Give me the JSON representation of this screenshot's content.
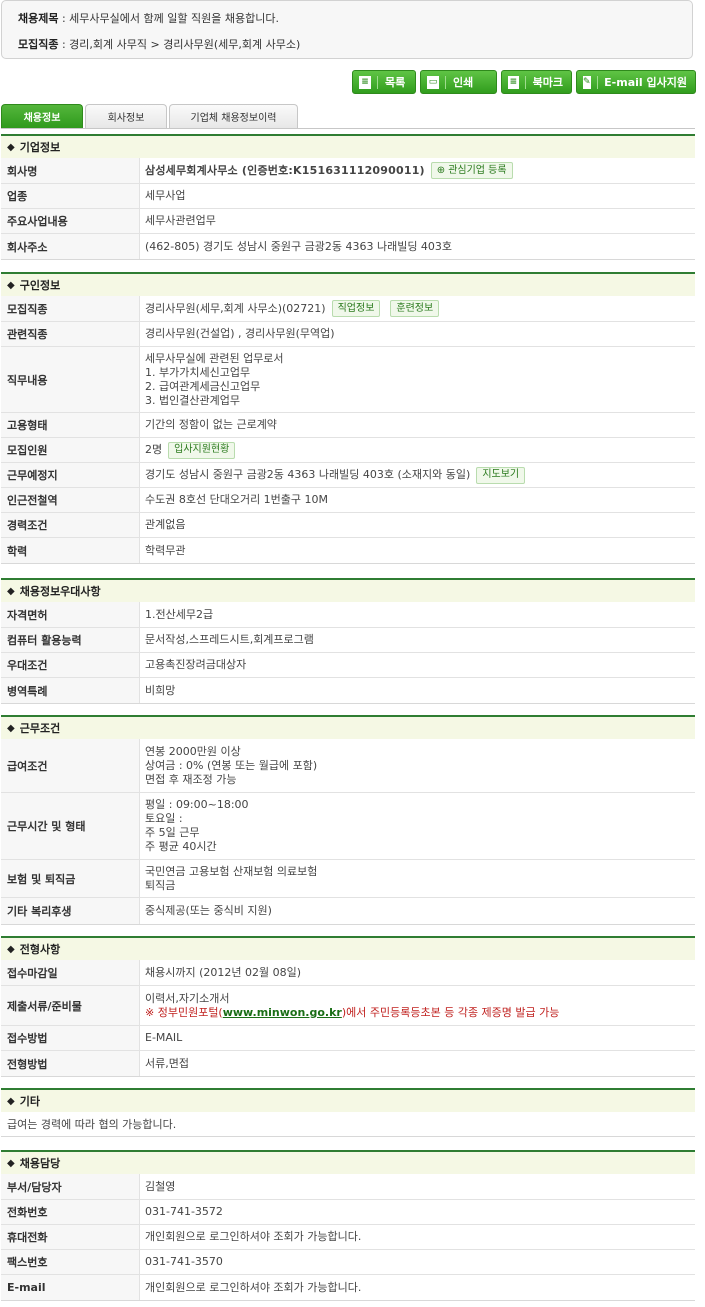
{
  "summary": {
    "title_label": "채용제목",
    "title_value": ": 세무사무실에서 함께 일할 직원을 채용합니다.",
    "job_label": "모집직종",
    "job_value": ": 경리,회계 사무직 > 경리사무원(세무,회계 사무소)"
  },
  "toolbar": {
    "list": "목록",
    "print": "인쇄",
    "bookmark": "북마크",
    "email_apply": "E-mail 입사지원"
  },
  "tabs": [
    "채용정보",
    "회사정보",
    "기업체 채용정보이력"
  ],
  "company": {
    "title": "기업정보",
    "name_label": "회사명",
    "name_value": "삼성세무회계사무소",
    "cert_value": "(인증번호:K151631112090011)",
    "interest_button": "관심기업 등록",
    "industry_label": "업종",
    "industry_value": "세무사업",
    "business_label": "주요사업내용",
    "business_value": "세무사관련업무",
    "address_label": "회사주소",
    "address_value": "(462-805) 경기도 성남시 중원구 금광2동 4363 나래빌딩 403호"
  },
  "recruit": {
    "title": "구인정보",
    "job_label": "모집직종",
    "job_value": "경리사무원(세무,회계 사무소)(02721)",
    "job_info_btn": "직업정보",
    "training_btn": "훈련정보",
    "related_label": "관련직종",
    "related_value": "경리사무원(건설업) , 경리사무원(무역업)",
    "duty_label": "직무내용",
    "duty_lines": [
      "세무사무실에 관련된 업무로서",
      "1. 부가가치세신고업무",
      "2. 급여관계세금신고업무",
      "3. 법인결산관계업무"
    ],
    "employ_label": "고용형태",
    "employ_value": "기간의 정함이 없는 근로계약",
    "count_label": "모집인원",
    "count_value": "2명",
    "count_btn": "입사지원현황",
    "location_label": "근무예정지",
    "location_value": "경기도 성남시 중원구 금광2동 4363 나래빌딩 403호 (소재지와 동일)",
    "map_btn": "지도보기",
    "subway_label": "인근전철역",
    "subway_value": "수도권 8호선 단대오거리 1번출구 10M",
    "career_label": "경력조건",
    "career_value": "관계없음",
    "edu_label": "학력",
    "edu_value": "학력무관"
  },
  "pref": {
    "title": "채용정보우대사항",
    "license_label": "자격면허",
    "license_value": "1.전산세무2급",
    "computer_label": "컴퓨터 활용능력",
    "computer_value": "문서작성,스프레드시트,회계프로그램",
    "prefer_label": "우대조건",
    "prefer_value": "고용촉진장려금대상자",
    "military_label": "병역특례",
    "military_value": "비희망"
  },
  "work": {
    "title": "근무조건",
    "salary_label": "급여조건",
    "salary_lines": [
      "연봉 2000만원 이상",
      "상여금 : 0% (연봉 또는 월급에 포함)",
      "면접 후 재조정 가능"
    ],
    "hours_label": "근무시간 및 형태",
    "hours_lines": [
      "평일 : 09:00~18:00",
      "토요일 :",
      "주 5일 근무",
      "주 평균 40시간"
    ],
    "insurance_label": "보험 및 퇴직금",
    "insurance_lines": [
      "국민연금 고용보험 산재보험 의료보험",
      "퇴직금"
    ],
    "welfare_label": "기타 복리후생",
    "welfare_value": "중식제공(또는 중식비 지원)"
  },
  "screening": {
    "title": "전형사항",
    "deadline_label": "접수마감일",
    "deadline_value": "채용시까지 (2012년 02월 08일)",
    "docs_label": "제출서류/준비물",
    "docs_value": "이력서,자기소개서",
    "notice_prefix": "※ 정부민원포털(",
    "notice_link": "www.minwon.go.kr",
    "notice_suffix": ")에서 주민등록등초본 등 각종 제증명 발급 가능",
    "method_label": "접수방법",
    "method_value": "E-MAIL",
    "process_label": "전형방법",
    "process_value": "서류,면접"
  },
  "etc": {
    "title": "기타",
    "text": "급여는 경력에 따라 협의 가능합니다."
  },
  "contact": {
    "title": "채용담당",
    "dept_label": "부서/담당자",
    "dept_value": "김철영",
    "phone_label": "전화번호",
    "phone_value": "031-741-3572",
    "mobile_label": "휴대전화",
    "mobile_value": "개인회원으로 로그인하셔야 조회가 가능합니다.",
    "fax_label": "팩스번호",
    "fax_value": "031-741-3570",
    "email_label": "E-mail",
    "email_value": "개인회원으로 로그인하셔야 조회가 가능합니다."
  }
}
